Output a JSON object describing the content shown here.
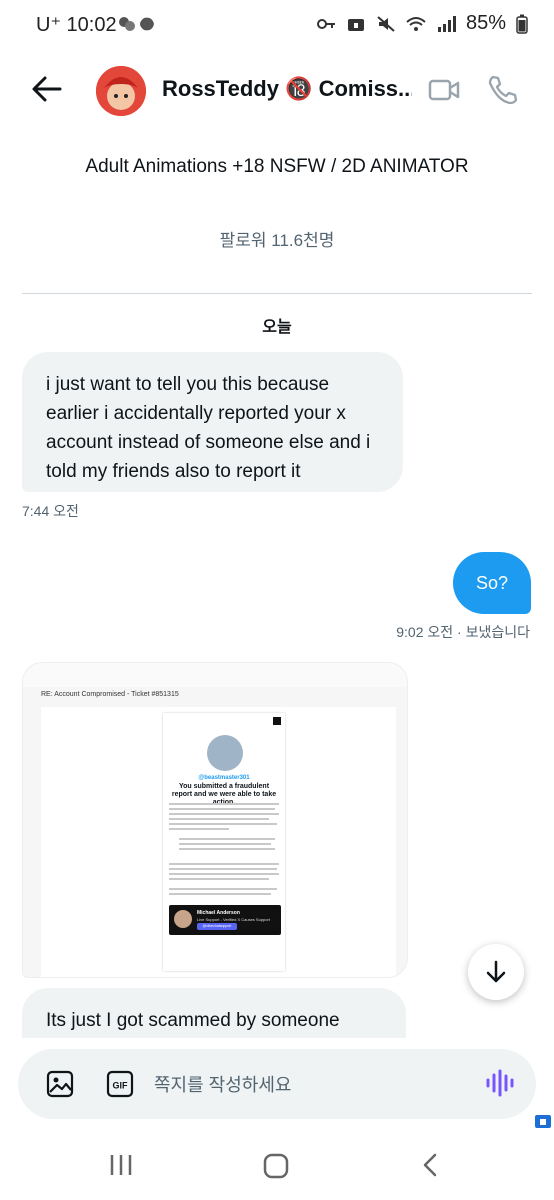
{
  "status_bar": {
    "carrier_time": "U⁺ 10:02",
    "battery": "85%"
  },
  "header": {
    "name": "RossTeddy 🔞 Comiss..."
  },
  "profile": {
    "bio": "Adult Animations +18 NSFW / 2D ANIMATOR",
    "followers": "팔로워 11.6천명"
  },
  "day_label": "오늘",
  "messages": [
    {
      "direction": "incoming",
      "text": "i just want to tell you this because earlier i accidentally reported your x account instead of someone else and i told my friends also to report it",
      "time": "7:44 오전"
    },
    {
      "direction": "outgoing",
      "text": "So?",
      "time": "9:02 오전 · 보냈습니다"
    },
    {
      "direction": "incoming",
      "type": "image",
      "image": {
        "subject": "RE: Account Compromised - Ticket #851315",
        "handle": "@beastmaster301",
        "headline": "You submitted a fraudulent report and we were able to take action.",
        "agent_name": "Michael Anderson",
        "agent_role": "Live Support - Verified X Causes Support",
        "agent_button": "@xlivechatsupport"
      }
    },
    {
      "direction": "incoming",
      "text": "Its just I got scammed by someone"
    }
  ],
  "composer": {
    "placeholder": "쪽지를 작성하세요"
  },
  "icons": [
    "back-arrow-icon",
    "video-call-icon",
    "phone-icon",
    "image-icon",
    "gif-icon",
    "voice-icon",
    "scroll-down-icon",
    "recents-icon",
    "home-icon",
    "nav-back-icon"
  ],
  "colors": {
    "accent": "#1d9bf0",
    "bubble_incoming": "#eff3f4",
    "voice_accent": "#7856ff"
  }
}
